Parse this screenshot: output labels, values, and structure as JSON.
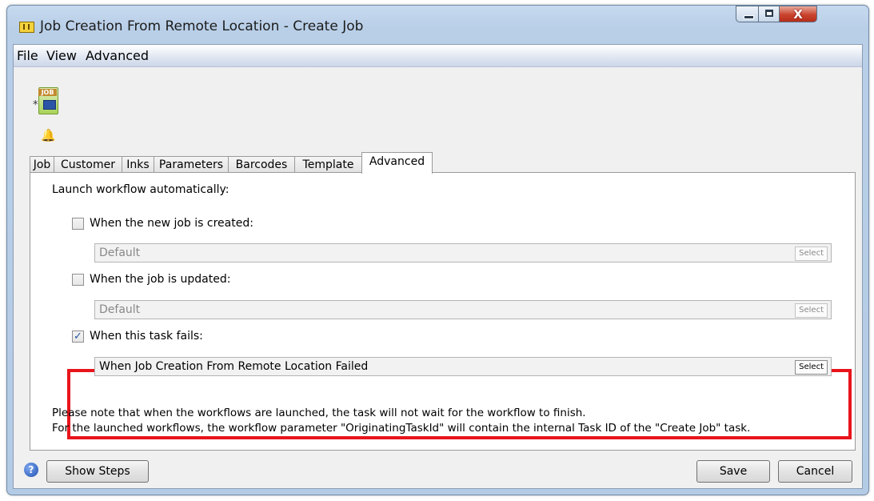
{
  "window": {
    "title": "Job Creation From Remote Location - Create Job",
    "controls": {
      "minimize": "—",
      "maximize": "□",
      "close": "X"
    }
  },
  "menu": [
    "File",
    "View",
    "Advanced"
  ],
  "job_icon": {
    "label": "JOB",
    "star": "*"
  },
  "tabs": [
    {
      "label": "Job"
    },
    {
      "label": "Customer"
    },
    {
      "label": "Inks"
    },
    {
      "label": "Parameters"
    },
    {
      "label": "Barcodes"
    },
    {
      "label": "Template"
    },
    {
      "label": "Advanced",
      "active": true
    }
  ],
  "advanced": {
    "heading": "Launch workflow automatically:",
    "options": [
      {
        "label": "When the new job is created:",
        "checked": false,
        "value": "Default",
        "select_label": "Select"
      },
      {
        "label": "When the job is updated:",
        "checked": false,
        "value": "Default",
        "select_label": "Select"
      },
      {
        "label": "When this task fails:",
        "checked": true,
        "value": "When Job Creation From Remote Location Failed",
        "select_label": "Select"
      }
    ],
    "checkmark": "✓",
    "note_line1": "Please note that when the workflows are launched, the task will not wait for the workflow to finish.",
    "note_line2": "For the launched workflows, the workflow parameter \"OriginatingTaskId\" will contain the internal Task ID of the \"Create Job\" task."
  },
  "footer": {
    "help_glyph": "?",
    "show_steps": "Show Steps",
    "save": "Save",
    "cancel": "Cancel"
  },
  "colors": {
    "highlight_border": "#e8141c",
    "title_bar": "#b9cfe8"
  }
}
